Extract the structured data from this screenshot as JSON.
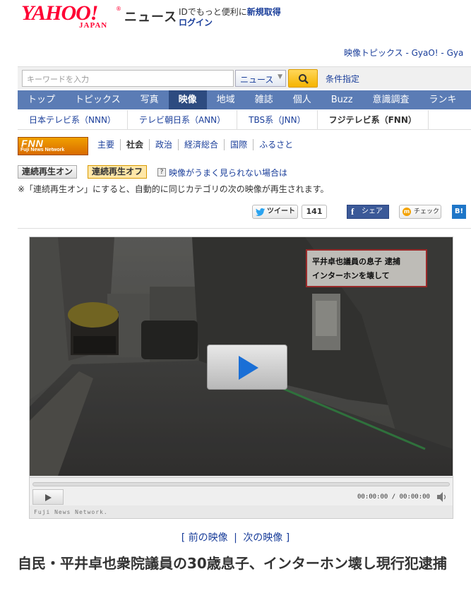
{
  "header": {
    "logo_text": "YAHOO!",
    "logo_sub": "JAPAN",
    "section": "ニュース",
    "id_message": "IDでもっと便利に",
    "signup": "新規取得",
    "login": "ログイン"
  },
  "top_links": {
    "video_topics": "映像トピックス - GyaO! - Gya"
  },
  "search": {
    "placeholder": "キーワードを入力",
    "category": "ニュース",
    "advanced": "条件指定"
  },
  "main_nav": [
    "トップ",
    "トピックス",
    "写真",
    "映像",
    "地域",
    "雑誌",
    "個人",
    "Buzz",
    "意識調査",
    "ランキ"
  ],
  "main_nav_active": "映像",
  "sub_nav": [
    "日本テレビ系（NNN）",
    "テレビ朝日系（ANN）",
    "TBS系（JNN）",
    "フジテレビ系（FNN）"
  ],
  "fnn": {
    "logo_big": "FNN",
    "logo_small": "Fuji News Network",
    "nav": [
      "主要",
      "社会",
      "政治",
      "経済総合",
      "国際",
      "ふるさと"
    ],
    "active": "社会"
  },
  "autoplay": {
    "on_label": "連続再生オン",
    "off_label": "連続再生オフ",
    "help_icon": "?",
    "help_link": "映像がうまく見られない場合は",
    "note": "※「連続再生オン」にすると、自動的に同じカテゴリの次の映像が再生されます。"
  },
  "social": {
    "tweet": "ツイート",
    "tweet_count": "141",
    "facebook": "シェア",
    "check": "チェック",
    "hatena": "B!"
  },
  "player": {
    "overlay_caption_line1": "平井卓也議員の息子 逮捕",
    "overlay_caption_line2": "インターホンを壊して",
    "time": "00:00:00 / 00:00:00",
    "credit": "Fuji News Network."
  },
  "pager": {
    "prev": "前の映像",
    "next": "次の映像"
  },
  "article": {
    "title": "自民・平井卓也衆院議員の30歳息子、インターホン壊し現行犯逮捕"
  },
  "colors": {
    "nav_bg": "#5b7cb5",
    "nav_active": "#2d4b80",
    "link": "#1a3e9a",
    "yahoo_red": "#ff0033",
    "fnn_orange": "#e07b00"
  }
}
